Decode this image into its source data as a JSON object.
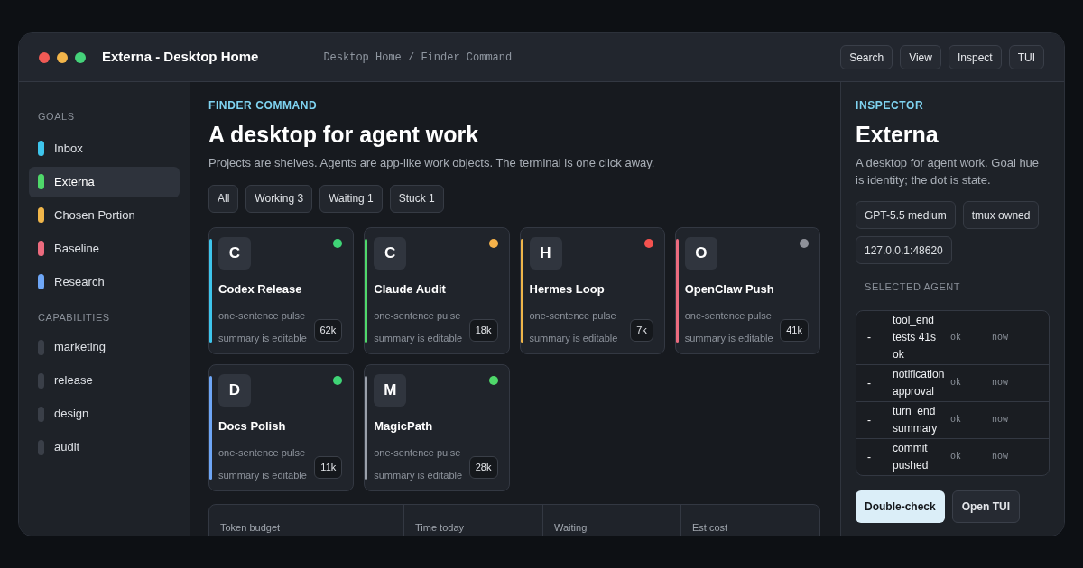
{
  "window": {
    "title": "Externa - Desktop Home",
    "breadcrumb": "Desktop Home / Finder Command",
    "buttons": [
      "Search",
      "View",
      "Inspect",
      "TUI"
    ]
  },
  "sidebar": {
    "goals_heading": "GOALS",
    "goals": [
      {
        "label": "Inbox",
        "color": "#3ec5ec",
        "selected": false
      },
      {
        "label": "Externa",
        "color": "#4fd86a",
        "selected": true
      },
      {
        "label": "Chosen Portion",
        "color": "#f0b64a",
        "selected": false
      },
      {
        "label": "Baseline",
        "color": "#ec6b7e",
        "selected": false
      },
      {
        "label": "Research",
        "color": "#6ea6f6",
        "selected": false
      }
    ],
    "capabilities_heading": "CAPABILITIES",
    "capabilities": [
      {
        "label": "marketing"
      },
      {
        "label": "release"
      },
      {
        "label": "design"
      },
      {
        "label": "audit"
      }
    ]
  },
  "main": {
    "eyebrow": "FINDER COMMAND",
    "title": "A desktop for agent work",
    "subtitle": "Projects are shelves. Agents are app-like work objects. The terminal is one click away.",
    "filters": [
      "All",
      "Working 3",
      "Waiting 1",
      "Stuck 1"
    ],
    "agents": [
      {
        "initial": "C",
        "name": "Codex Release",
        "pulse": "one-sentence pulse",
        "summary": "summary is editable",
        "tokens": "62k",
        "color": "#3ec5ec",
        "status": {
          "color": "#3fd476"
        }
      },
      {
        "initial": "C",
        "name": "Claude Audit",
        "pulse": "one-sentence pulse",
        "summary": "summary is editable",
        "tokens": "18k",
        "color": "#4fd86a",
        "status": {
          "color": "#f5b24a"
        }
      },
      {
        "initial": "H",
        "name": "Hermes Loop",
        "pulse": "one-sentence pulse",
        "summary": "summary is editable",
        "tokens": "7k",
        "color": "#f0b64a",
        "status": {
          "color": "#f4524f"
        }
      },
      {
        "initial": "O",
        "name": "OpenClaw Push",
        "pulse": "one-sentence pulse",
        "summary": "summary is editable",
        "tokens": "41k",
        "color": "#ec6b7e",
        "status": {
          "color": "#8e9199"
        }
      },
      {
        "initial": "D",
        "name": "Docs Polish",
        "pulse": "one-sentence pulse",
        "summary": "summary is editable",
        "tokens": "11k",
        "color": "#6ea6f6",
        "status": {
          "color": "#3fd476"
        }
      },
      {
        "initial": "M",
        "name": "MagicPath",
        "pulse": "one-sentence pulse",
        "summary": "summary is editable",
        "tokens": "28k",
        "color": "#9aa0aa",
        "status": {
          "color": "#4fd86a"
        }
      }
    ],
    "stats": [
      "Token budget",
      "Time today",
      "Waiting",
      "Est cost"
    ]
  },
  "inspector": {
    "eyebrow": "INSPECTOR",
    "title": "Externa",
    "description": "A desktop for agent work. Goal hue is identity; the dot is state.",
    "tags": [
      "GPT-5.5 medium",
      "tmux owned",
      "127.0.0.1:48620"
    ],
    "section_heading": "SELECTED AGENT",
    "events": [
      {
        "marker": "-",
        "text": "tool_end tests 41s ok",
        "status": "ok",
        "time": "now"
      },
      {
        "marker": "-",
        "text": "notification approval",
        "status": "ok",
        "time": "now"
      },
      {
        "marker": "-",
        "text": "turn_end summary",
        "status": "ok",
        "time": "now"
      },
      {
        "marker": "-",
        "text": "commit pushed",
        "status": "ok",
        "time": "now"
      }
    ],
    "actions": [
      {
        "label": "Double-check",
        "kind": "primary"
      },
      {
        "label": "Open TUI",
        "kind": "secondary"
      }
    ]
  }
}
